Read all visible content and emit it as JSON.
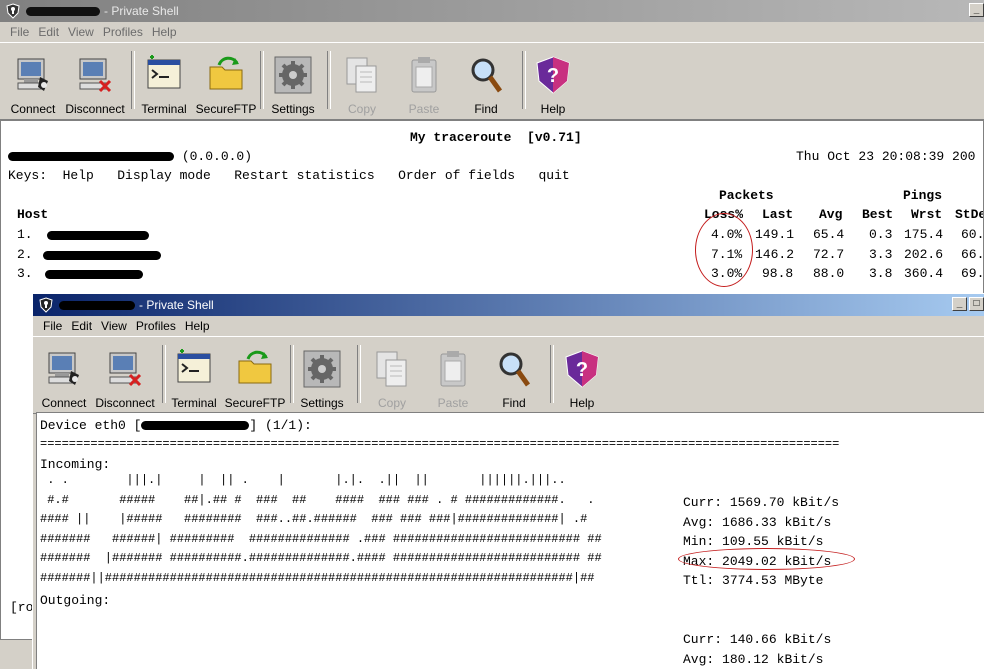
{
  "back_window": {
    "title": "- Private Shell",
    "menu": [
      "File",
      "Edit",
      "View",
      "Profiles",
      "Help"
    ],
    "toolbar": [
      "Connect",
      "Disconnect",
      "Terminal",
      "SecureFTP",
      "Settings",
      "Copy",
      "Paste",
      "Find",
      "Help"
    ],
    "terminal": {
      "header_title": "My traceroute  [v0.71]",
      "host_addr": "(0.0.0.0)",
      "date": "Thu Oct 23 20:08:39 200",
      "keys_line": "Keys:  Help   Display mode   Restart statistics   Order of fields   quit",
      "group_packets": "Packets",
      "group_pings": "Pings",
      "col_host": "Host",
      "cols": [
        "Loss%",
        "Last",
        "Avg",
        "Best",
        "Wrst",
        "StDe"
      ],
      "rows": [
        {
          "num": "1.",
          "loss": "4.0%",
          "last": "149.1",
          "avg": "65.4",
          "best": "0.3",
          "wrst": "175.4",
          "stdev": "60."
        },
        {
          "num": "2.",
          "loss": "7.1%",
          "last": "146.2",
          "avg": "72.7",
          "best": "3.3",
          "wrst": "202.6",
          "stdev": "66."
        },
        {
          "num": "3.",
          "loss": "3.0%",
          "last": "98.8",
          "avg": "88.0",
          "best": "3.8",
          "wrst": "360.4",
          "stdev": "69."
        }
      ],
      "left_edge_text": "[ro"
    }
  },
  "front_window": {
    "title": "- Private Shell",
    "menu": [
      "File",
      "Edit",
      "View",
      "Profiles",
      "Help"
    ],
    "toolbar": [
      "Connect",
      "Disconnect",
      "Terminal",
      "SecureFTP",
      "Settings",
      "Copy",
      "Paste",
      "Find",
      "Help"
    ],
    "terminal": {
      "device_prefix": "Device eth0 [",
      "device_suffix": "] (1/1):",
      "separator": "===============================================================================================================",
      "incoming_label": "Incoming:",
      "outgoing_label": "Outgoing:",
      "histogram": [
        " . .        |||.|     |  || .    |       |.|.  .||  ||       ||||||.|||..",
        " #.#       #####    ##|.## #  ###  ##    ####  ### ### . # #############.   .",
        "#### ||    |#####   ########  ###..##.######  ### ### ###|##############| .#",
        "#######   ######| #########  ############## .### ########################## ##",
        "#######  |####### ##########.##############.#### ########################## ##",
        "#######||#################################################################|##"
      ],
      "incoming_stats": [
        {
          "label": "Curr:",
          "value": "1569.70 kBit/s"
        },
        {
          "label": "Avg:",
          "value": "1686.33 kBit/s"
        },
        {
          "label": "Min:",
          "value": "109.55 kBit/s"
        },
        {
          "label": "Max:",
          "value": "2049.02 kBit/s"
        },
        {
          "label": "Ttl:",
          "value": "3774.53 MByte"
        }
      ],
      "outgoing_stats": [
        {
          "label": "Curr:",
          "value": "140.66 kBit/s"
        },
        {
          "label": "Avg:",
          "value": "180.12 kBit/s"
        }
      ]
    }
  },
  "icons": [
    "connect-icon",
    "disconnect-icon",
    "terminal-icon",
    "secureftp-icon",
    "settings-icon",
    "copy-icon",
    "paste-icon",
    "find-icon",
    "help-icon"
  ],
  "colors": {
    "annotation_red": "#c41e1e",
    "active_title": "#0a246a"
  }
}
